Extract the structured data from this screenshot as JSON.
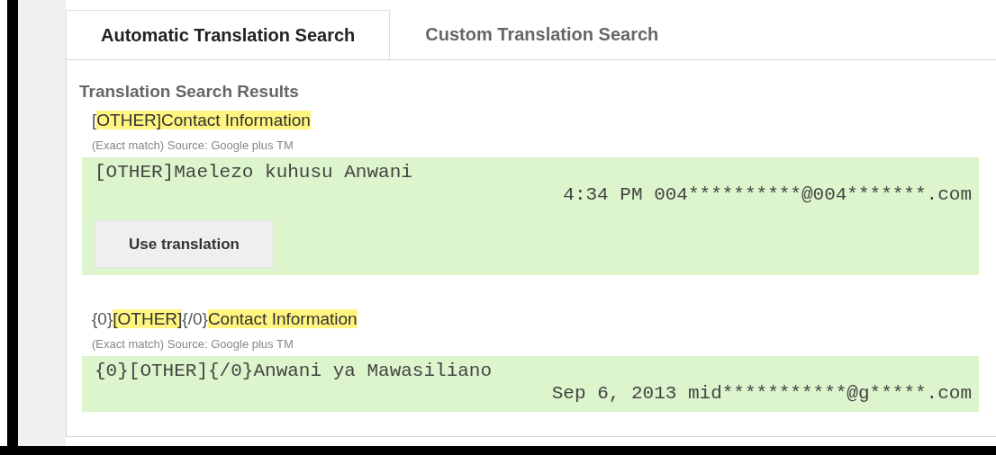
{
  "tabs": [
    {
      "label": "Automatic Translation Search",
      "selected": true
    },
    {
      "label": "Custom Translation Search",
      "selected": false
    }
  ],
  "results_heading": "Translation Search Results",
  "results": [
    {
      "source": [
        {
          "text": "[",
          "highlighted": false
        },
        {
          "text": "OTHER]Contact Information",
          "highlighted": true
        }
      ],
      "meta": "(Exact match) Source: Google plus TM",
      "translation": "[OTHER]Maelezo kuhusu Anwani",
      "info": "4:34 PM 004**********@004*******.com",
      "button": "Use translation"
    },
    {
      "source": [
        {
          "text": "{0}",
          "highlighted": false
        },
        {
          "text": "[OTHER]",
          "highlighted": true
        },
        {
          "text": "{/0}",
          "highlighted": false
        },
        {
          "text": "Contact Information",
          "highlighted": true
        }
      ],
      "meta": "(Exact match) Source: Google plus TM",
      "translation": "{0}[OTHER]{/0}Anwani ya Mawasiliano",
      "info": "Sep 6, 2013 mid***********@g*****.com"
    }
  ]
}
